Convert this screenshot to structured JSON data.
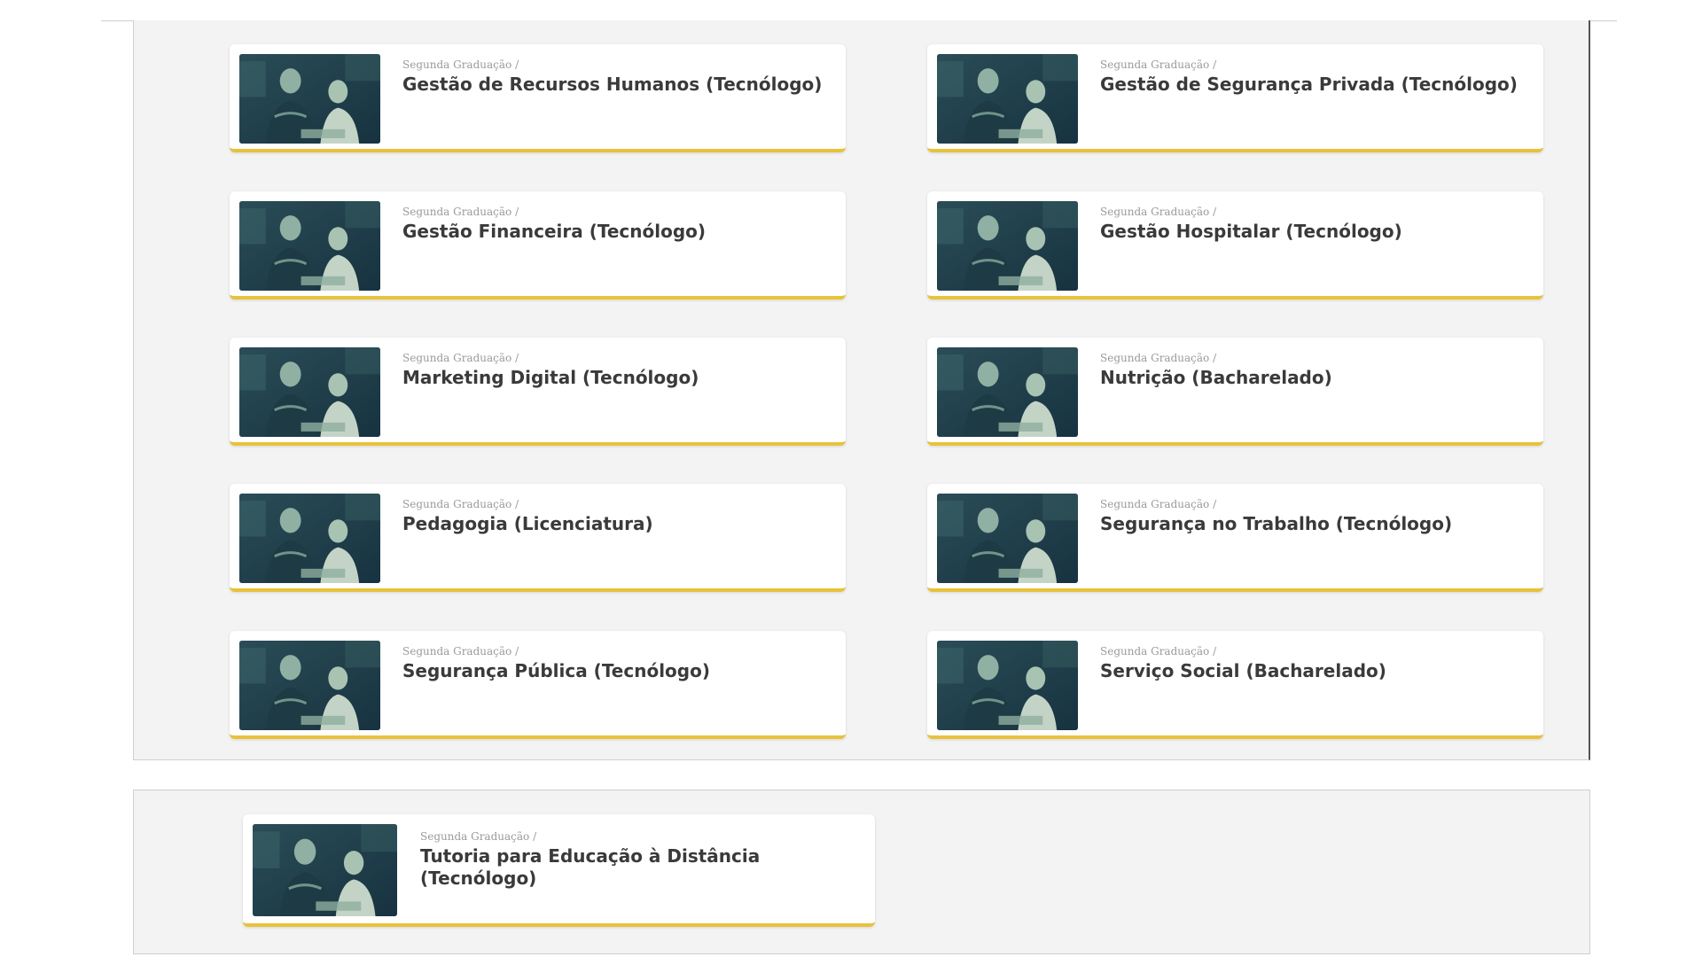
{
  "courses": [
    {
      "crumb": "Segunda Graduação /",
      "title": "Gestão de Recursos Humanos (Tecnólogo)"
    },
    {
      "crumb": "Segunda Graduação /",
      "title": "Gestão de Segurança Privada (Tecnólogo)"
    },
    {
      "crumb": "Segunda Graduação /",
      "title": "Gestão Financeira (Tecnólogo)"
    },
    {
      "crumb": "Segunda Graduação /",
      "title": "Gestão Hospitalar (Tecnólogo)"
    },
    {
      "crumb": "Segunda Graduação /",
      "title": "Marketing Digital (Tecnólogo)"
    },
    {
      "crumb": "Segunda Graduação /",
      "title": "Nutrição (Bacharelado)"
    },
    {
      "crumb": "Segunda Graduação /",
      "title": "Pedagogia (Licenciatura)"
    },
    {
      "crumb": "Segunda Graduação /",
      "title": "Segurança no Trabalho (Tecnólogo)"
    },
    {
      "crumb": "Segunda Graduação /",
      "title": "Segurança Pública (Tecnólogo)"
    },
    {
      "crumb": "Segunda Graduação /",
      "title": "Serviço Social (Bacharelado)"
    },
    {
      "crumb": "Segunda Graduação /",
      "title": "Tutoria para Educação à Distância (Tecnólogo)"
    }
  ],
  "colors": {
    "accent_underline": "#e8c23a",
    "panel_bg": "#f3f3f3",
    "title_text": "#3a3a3a",
    "crumb_text": "#9a9a9a",
    "thumbnail_tint": "#1c3a4a"
  },
  "icons": {
    "thumbnail": "course-photo-thumbnail"
  }
}
